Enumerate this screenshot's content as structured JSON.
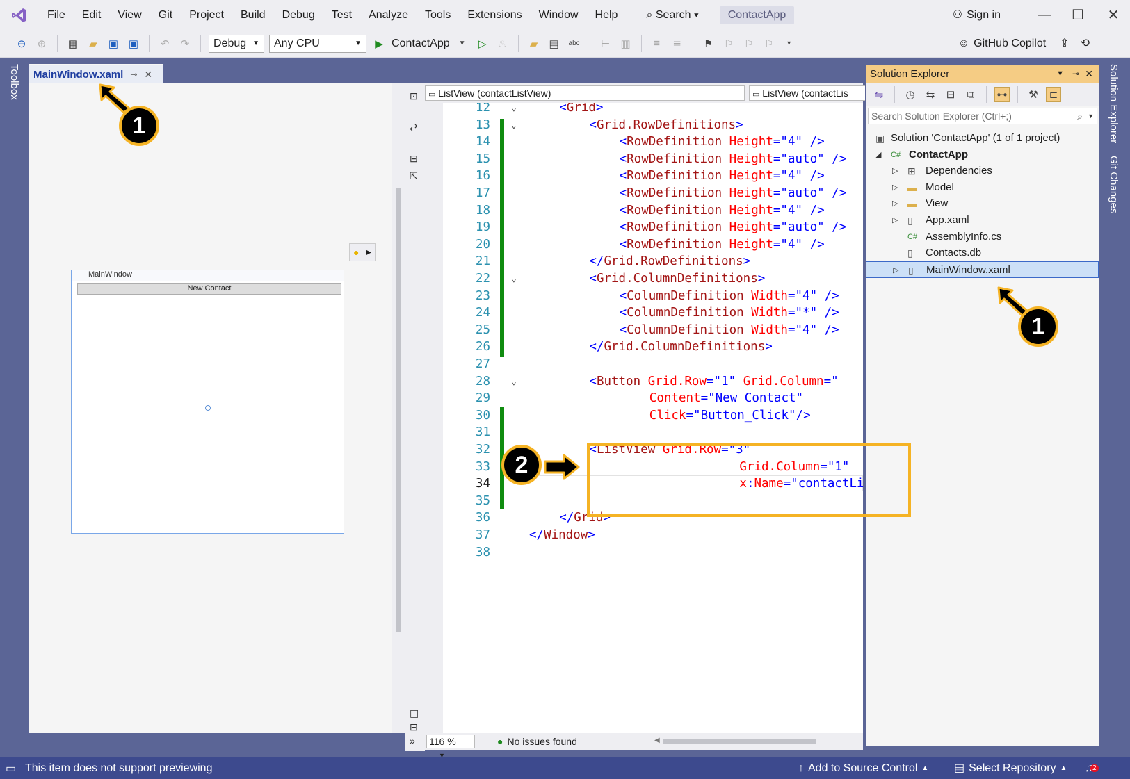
{
  "menu": [
    "File",
    "Edit",
    "View",
    "Git",
    "Project",
    "Build",
    "Debug",
    "Test",
    "Analyze",
    "Tools",
    "Extensions",
    "Window",
    "Help"
  ],
  "search_label": "Search",
  "solution_pill": "ContactApp",
  "sign_in": "Sign in",
  "toolbar": {
    "config": "Debug",
    "platform": "Any CPU",
    "run_target": "ContactApp",
    "copilot": "GitHub Copilot"
  },
  "left_strip": {
    "toolbox": "Toolbox"
  },
  "document_tab": {
    "title": "MainWindow.xaml"
  },
  "designer": {
    "window_title": "MainWindow",
    "button_text": "New Contact"
  },
  "nav_bar": {
    "left": "ListView (contactListView)",
    "right": "ListView (contactLis"
  },
  "code_lines": [
    {
      "n": "12",
      "parts": [
        [
          "br",
          "<"
        ],
        [
          "tag",
          "Grid"
        ],
        [
          "br",
          ">"
        ]
      ],
      "indent": 2,
      "fold": true
    },
    {
      "n": "13",
      "parts": [
        [
          "br",
          "<"
        ],
        [
          "tag",
          "Grid.RowDefinitions"
        ],
        [
          "br",
          ">"
        ]
      ],
      "indent": 4,
      "fold": true
    },
    {
      "n": "14",
      "parts": [
        [
          "br",
          "<"
        ],
        [
          "tag",
          "RowDefinition "
        ],
        [
          "attr",
          "Height"
        ],
        [
          "br",
          "="
        ],
        [
          "val",
          "\"4\""
        ],
        [
          "br",
          " />"
        ]
      ],
      "indent": 6
    },
    {
      "n": "15",
      "parts": [
        [
          "br",
          "<"
        ],
        [
          "tag",
          "RowDefinition "
        ],
        [
          "attr",
          "Height"
        ],
        [
          "br",
          "="
        ],
        [
          "val",
          "\"auto\""
        ],
        [
          "br",
          " />"
        ]
      ],
      "indent": 6
    },
    {
      "n": "16",
      "parts": [
        [
          "br",
          "<"
        ],
        [
          "tag",
          "RowDefinition "
        ],
        [
          "attr",
          "Height"
        ],
        [
          "br",
          "="
        ],
        [
          "val",
          "\"4\""
        ],
        [
          "br",
          " />"
        ]
      ],
      "indent": 6
    },
    {
      "n": "17",
      "parts": [
        [
          "br",
          "<"
        ],
        [
          "tag",
          "RowDefinition "
        ],
        [
          "attr",
          "Height"
        ],
        [
          "br",
          "="
        ],
        [
          "val",
          "\"auto\""
        ],
        [
          "br",
          " />"
        ]
      ],
      "indent": 6
    },
    {
      "n": "18",
      "parts": [
        [
          "br",
          "<"
        ],
        [
          "tag",
          "RowDefinition "
        ],
        [
          "attr",
          "Height"
        ],
        [
          "br",
          "="
        ],
        [
          "val",
          "\"4\""
        ],
        [
          "br",
          " />"
        ]
      ],
      "indent": 6
    },
    {
      "n": "19",
      "parts": [
        [
          "br",
          "<"
        ],
        [
          "tag",
          "RowDefinition "
        ],
        [
          "attr",
          "Height"
        ],
        [
          "br",
          "="
        ],
        [
          "val",
          "\"auto\""
        ],
        [
          "br",
          " />"
        ]
      ],
      "indent": 6
    },
    {
      "n": "20",
      "parts": [
        [
          "br",
          "<"
        ],
        [
          "tag",
          "RowDefinition "
        ],
        [
          "attr",
          "Height"
        ],
        [
          "br",
          "="
        ],
        [
          "val",
          "\"4\""
        ],
        [
          "br",
          " />"
        ]
      ],
      "indent": 6
    },
    {
      "n": "21",
      "parts": [
        [
          "br",
          "</"
        ],
        [
          "tag",
          "Grid.RowDefinitions"
        ],
        [
          "br",
          ">"
        ]
      ],
      "indent": 4
    },
    {
      "n": "22",
      "parts": [
        [
          "br",
          "<"
        ],
        [
          "tag",
          "Grid.ColumnDefinitions"
        ],
        [
          "br",
          ">"
        ]
      ],
      "indent": 4,
      "fold": true
    },
    {
      "n": "23",
      "parts": [
        [
          "br",
          "<"
        ],
        [
          "tag",
          "ColumnDefinition "
        ],
        [
          "attr",
          "Width"
        ],
        [
          "br",
          "="
        ],
        [
          "val",
          "\"4\""
        ],
        [
          "br",
          " />"
        ]
      ],
      "indent": 6
    },
    {
      "n": "24",
      "parts": [
        [
          "br",
          "<"
        ],
        [
          "tag",
          "ColumnDefinition "
        ],
        [
          "attr",
          "Width"
        ],
        [
          "br",
          "="
        ],
        [
          "val",
          "\"*\""
        ],
        [
          "br",
          " />"
        ]
      ],
      "indent": 6
    },
    {
      "n": "25",
      "parts": [
        [
          "br",
          "<"
        ],
        [
          "tag",
          "ColumnDefinition "
        ],
        [
          "attr",
          "Width"
        ],
        [
          "br",
          "="
        ],
        [
          "val",
          "\"4\""
        ],
        [
          "br",
          " />"
        ]
      ],
      "indent": 6
    },
    {
      "n": "26",
      "parts": [
        [
          "br",
          "</"
        ],
        [
          "tag",
          "Grid.ColumnDefinitions"
        ],
        [
          "br",
          ">"
        ]
      ],
      "indent": 4
    },
    {
      "n": "27",
      "parts": [],
      "indent": 0
    },
    {
      "n": "28",
      "parts": [
        [
          "br",
          "<"
        ],
        [
          "tag",
          "Button "
        ],
        [
          "attr",
          "Grid.Row"
        ],
        [
          "br",
          "="
        ],
        [
          "val",
          "\"1\" "
        ],
        [
          "attr",
          "Grid.Column"
        ],
        [
          "br",
          "=\""
        ]
      ],
      "indent": 4,
      "fold": true
    },
    {
      "n": "29",
      "parts": [
        [
          "attr",
          "Content"
        ],
        [
          "br",
          "="
        ],
        [
          "val",
          "\"New Contact\""
        ]
      ],
      "indent": 8
    },
    {
      "n": "30",
      "parts": [
        [
          "attr",
          "Click"
        ],
        [
          "br",
          "="
        ],
        [
          "val",
          "\"Button_Click\""
        ],
        [
          "br",
          "/>"
        ]
      ],
      "indent": 8
    },
    {
      "n": "31",
      "parts": [],
      "indent": 0
    },
    {
      "n": "32",
      "parts": [
        [
          "br",
          "<"
        ],
        [
          "tag",
          "ListView "
        ],
        [
          "attr",
          "Grid.Row"
        ],
        [
          "br",
          "="
        ],
        [
          "val",
          "\"3\""
        ]
      ],
      "indent": 4
    },
    {
      "n": "33",
      "parts": [
        [
          "attr",
          "Grid.Column"
        ],
        [
          "br",
          "="
        ],
        [
          "val",
          "\"1\""
        ]
      ],
      "indent": 14
    },
    {
      "n": "34",
      "parts": [
        [
          "attr",
          "x"
        ],
        [
          "br",
          ":"
        ],
        [
          "attr",
          "Name"
        ],
        [
          "br",
          "="
        ],
        [
          "val",
          "\"contactListView\""
        ]
      ],
      "indent": 14,
      "current": true
    },
    {
      "n": "35",
      "parts": [],
      "indent": 0
    },
    {
      "n": "36",
      "parts": [
        [
          "br",
          "</"
        ],
        [
          "tag",
          "Grid"
        ],
        [
          "br",
          ">"
        ]
      ],
      "indent": 2
    },
    {
      "n": "37",
      "parts": [
        [
          "br",
          "</"
        ],
        [
          "tag",
          "Window"
        ],
        [
          "br",
          ">"
        ]
      ],
      "indent": 0
    },
    {
      "n": "38",
      "parts": [],
      "indent": 0
    }
  ],
  "editor_status": {
    "zoom": "116 %",
    "issues": "No issues found"
  },
  "solution_explorer": {
    "title": "Solution Explorer",
    "search_placeholder": "Search Solution Explorer (Ctrl+;)",
    "tree": [
      {
        "label": "Solution 'ContactApp' (1 of 1 project)",
        "level": 0,
        "icon": "solution-icon",
        "glyph": "▣",
        "exp": ""
      },
      {
        "label": "ContactApp",
        "level": 1,
        "icon": "csharp-project-icon",
        "glyph": "C#",
        "exp": "◢",
        "bold": true
      },
      {
        "label": "Dependencies",
        "level": 2,
        "icon": "dependencies-icon",
        "glyph": "⊞",
        "exp": "▷"
      },
      {
        "label": "Model",
        "level": 2,
        "icon": "folder-icon",
        "glyph": "▬",
        "exp": "▷"
      },
      {
        "label": "View",
        "level": 2,
        "icon": "folder-icon",
        "glyph": "▬",
        "exp": "▷"
      },
      {
        "label": "App.xaml",
        "level": 2,
        "icon": "xaml-file-icon",
        "glyph": "▯",
        "exp": "▷"
      },
      {
        "label": "AssemblyInfo.cs",
        "level": 2,
        "icon": "csharp-file-icon",
        "glyph": "C#",
        "exp": ""
      },
      {
        "label": "Contacts.db",
        "level": 2,
        "icon": "database-file-icon",
        "glyph": "▯",
        "exp": ""
      },
      {
        "label": "MainWindow.xaml",
        "level": 2,
        "icon": "xaml-file-icon",
        "glyph": "▯",
        "exp": "▷",
        "selected": true
      }
    ]
  },
  "right_strip": {
    "solution_explorer": "Solution Explorer",
    "git_changes": "Git Changes"
  },
  "statusbar": {
    "message": "This item does not support previewing",
    "add_source": "Add to Source Control",
    "select_repo": "Select Repository",
    "notifications": "2"
  },
  "annotations": {
    "badge1": "1",
    "badge2": "2"
  },
  "colors": {
    "accent_yellow": "#f5b324",
    "vs_purple": "#5b6596",
    "code_tag": "#a31515",
    "code_attr": "#ff0000",
    "code_value": "#0000ff"
  }
}
